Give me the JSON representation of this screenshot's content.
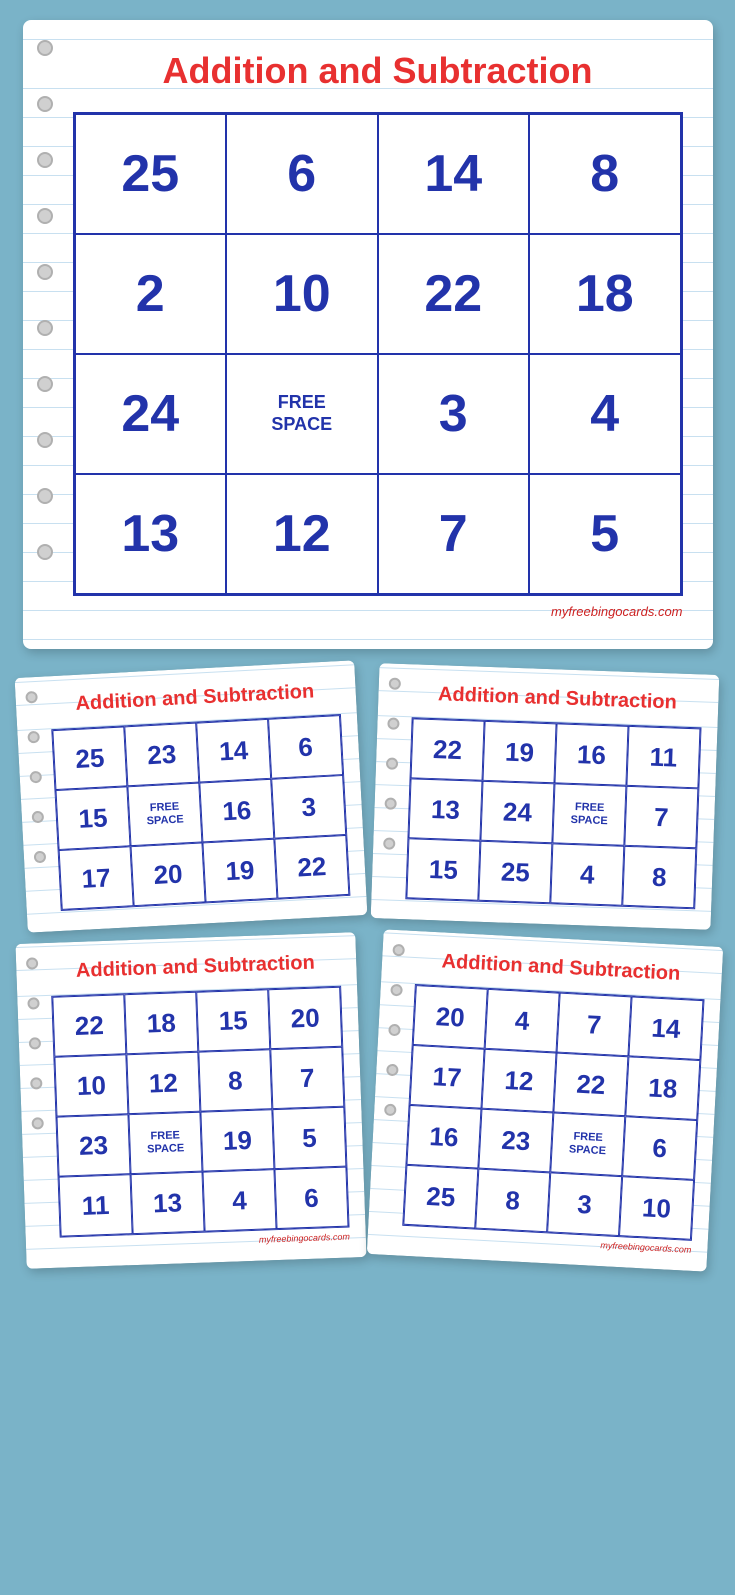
{
  "main_card": {
    "title": "Addition and Subtraction",
    "grid": [
      [
        "25",
        "6",
        "14",
        "8"
      ],
      [
        "2",
        "10",
        "22",
        "18"
      ],
      [
        "24",
        "FREE SPACE",
        "3",
        "4"
      ],
      [
        "13",
        "12",
        "7",
        "5"
      ]
    ],
    "watermark": "myfreebingocards.com"
  },
  "card_tl": {
    "title": "Addition and Subtraction",
    "grid": [
      [
        "25",
        "23",
        "14",
        "6"
      ],
      [
        "15",
        "FREE SPACE",
        "16",
        "3"
      ],
      [
        "17",
        "20",
        "19",
        "22"
      ]
    ],
    "watermark": ""
  },
  "card_tr": {
    "title": "Addition and Subtraction",
    "grid": [
      [
        "22",
        "19",
        "16",
        "11"
      ],
      [
        "13",
        "24",
        "FREE SPACE",
        "7"
      ],
      [
        "15",
        "25",
        "4",
        "8"
      ]
    ],
    "watermark": ""
  },
  "card_bl": {
    "title": "Addition and Subtraction",
    "grid": [
      [
        "22",
        "18",
        "15",
        "20"
      ],
      [
        "10",
        "12",
        "8",
        "7"
      ],
      [
        "23",
        "FREE SPACE",
        "19",
        "5"
      ],
      [
        "11",
        "13",
        "4",
        "6"
      ]
    ],
    "watermark": "myfreebingocards.com"
  },
  "card_br": {
    "title": "Addition and Subtraction",
    "grid": [
      [
        "20",
        "4",
        "7",
        "14"
      ],
      [
        "17",
        "12",
        "22",
        "18"
      ],
      [
        "16",
        "23",
        "FREE SPACE",
        "6"
      ],
      [
        "25",
        "8",
        "3",
        "10"
      ]
    ],
    "watermark": "myfreebingocards.com"
  }
}
